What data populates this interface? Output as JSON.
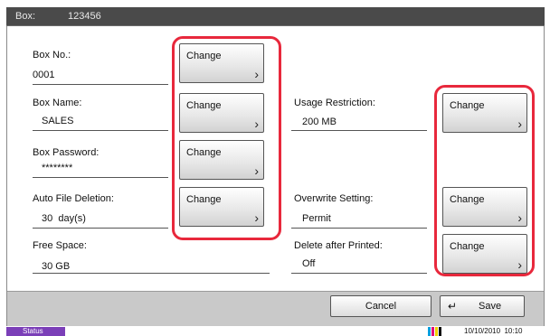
{
  "titlebar": {
    "label": "Box:",
    "box_number": "123456"
  },
  "fields": {
    "box_no": {
      "label": "Box No.:",
      "value": "0001"
    },
    "box_name": {
      "label": "Box Name:",
      "value": "SALES"
    },
    "box_password": {
      "label": "Box Password:",
      "value": "********"
    },
    "auto_file_deletion": {
      "label": "Auto File Deletion:",
      "value": "30  day(s)"
    },
    "free_space": {
      "label": "Free Space:",
      "value": "30 GB"
    },
    "usage_restriction": {
      "label": "Usage Restriction:",
      "value": "200 MB"
    },
    "overwrite_setting": {
      "label": "Overwrite Setting:",
      "value": "Permit"
    },
    "delete_after_printed": {
      "label": "Delete after Printed:",
      "value": "Off"
    }
  },
  "change_label": "Change",
  "chevron": "›",
  "footer": {
    "cancel_label": "Cancel",
    "save_label": "Save",
    "save_icon": "↵"
  },
  "status": {
    "label": "Status",
    "datetime": "10/10/2010  10:10"
  },
  "colors": {
    "highlight": "#e8283c",
    "status": "#7b3fb8"
  }
}
